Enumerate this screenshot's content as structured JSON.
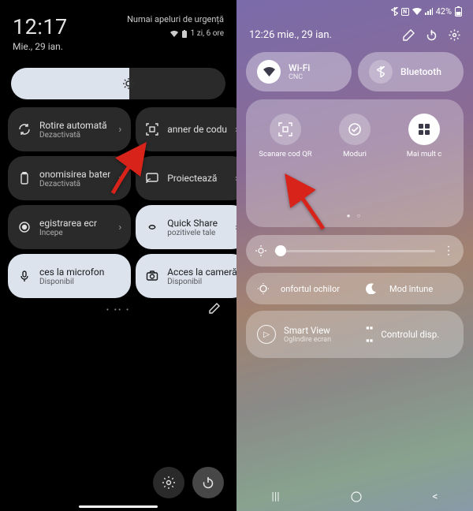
{
  "left": {
    "time": "12:17",
    "date": "Mie., 29 ian.",
    "emergency": "Numai apeluri de urgență",
    "battery_text": "1 zi, 6 ore",
    "tiles": [
      {
        "icon": "rotate",
        "label": "Rotire automată",
        "sub": "Dezactivată",
        "style": "dark"
      },
      {
        "icon": "qr",
        "label": "anner de codu",
        "sub": "",
        "style": "dark"
      },
      {
        "icon": "battery",
        "label": "onomisirea bater",
        "sub": "Dezactivată",
        "style": "dark"
      },
      {
        "icon": "cast",
        "label": "Proiectează",
        "sub": "",
        "style": "dark"
      },
      {
        "icon": "record",
        "label": "egistrarea ecr",
        "sub": "Începe",
        "style": "dark"
      },
      {
        "icon": "share",
        "label": "Quick Share",
        "sub": "pozitivele tale",
        "style": "light"
      },
      {
        "icon": "mic",
        "label": "ces la microfon",
        "sub": "Disponibil",
        "style": "light"
      },
      {
        "icon": "camera",
        "label": "Acces la cameră",
        "sub": "Disponibil",
        "style": "light"
      }
    ]
  },
  "right": {
    "status_battery": "42%",
    "time_date": "12:26  mie., 29 ian.",
    "wifi": {
      "label": "Wi-Fi",
      "sub": "CNC"
    },
    "bluetooth": {
      "label": "Bluetooth"
    },
    "shortcuts": [
      {
        "icon": "qr",
        "label": "Scanare cod QR",
        "style": "off"
      },
      {
        "icon": "check",
        "label": "Moduri",
        "style": "off"
      },
      {
        "icon": "grid",
        "label": "Mai mult c",
        "style": "on"
      }
    ],
    "eye_comfort": "onfortul ochilor",
    "dark_mode": "Mod întune",
    "smartview": {
      "label": "Smart View",
      "sub": "Oglindire ecran"
    },
    "device_control": "Controlul disp."
  }
}
